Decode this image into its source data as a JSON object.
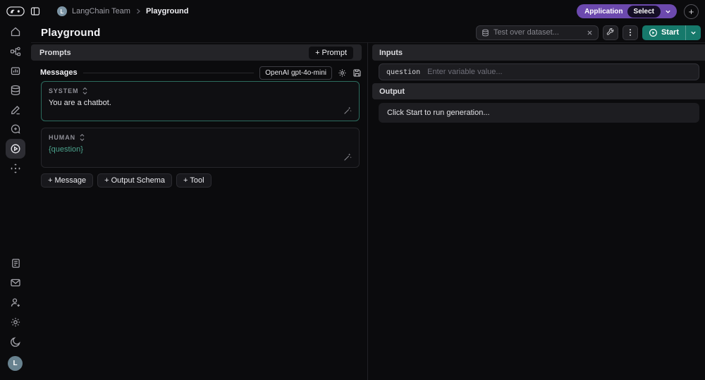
{
  "topbar": {
    "logo_icon": "langsmith-logo",
    "panel_icon": "sidebar-toggle-icon",
    "breadcrumb": {
      "avatar_letter": "L",
      "team": "LangChain Team",
      "page": "Playground"
    },
    "application_button": {
      "label": "Application",
      "select_label": "Select",
      "chevron_icon": "chevron-down-icon"
    },
    "new_button_label": "+"
  },
  "header": {
    "title": "Playground",
    "dataset_search": {
      "placeholder": "Test over dataset...",
      "value": "",
      "left_icon": "database-icon",
      "clear_icon": "x-icon"
    },
    "wrench_icon": "wrench-icon",
    "more_icon": "kebab-menu-icon",
    "start_button": {
      "label": "Start",
      "icon": "play-circle-icon",
      "chevron_icon": "chevron-down-icon"
    }
  },
  "sidebar": {
    "top_icons": [
      "home",
      "tracing-projects",
      "monitoring",
      "datasets",
      "annotation-queues",
      "feedback",
      "playground",
      "deployments"
    ],
    "active_item": "playground",
    "bottom_icons": [
      "docs",
      "email",
      "invite-user",
      "settings",
      "dark-mode"
    ],
    "avatar_letter": "L"
  },
  "prompts_panel": {
    "header": "Prompts",
    "add_prompt_label": "+ Prompt",
    "messages_label": "Messages",
    "model_label": "OpenAI gpt-4o-mini",
    "model_icons": [
      "gear-icon",
      "save-icon"
    ],
    "messages": [
      {
        "role": "SYSTEM",
        "content": "You are a chatbot."
      },
      {
        "role": "HUMAN",
        "content": "{question}"
      }
    ],
    "add_buttons": {
      "message": "+ Message",
      "output_schema": "+ Output Schema",
      "tool": "+ Tool"
    }
  },
  "io_panel": {
    "inputs_header": "Inputs",
    "variable": {
      "name": "question",
      "placeholder": "Enter variable value...",
      "value": ""
    },
    "output_header": "Output",
    "output_placeholder": "Click Start to run generation..."
  },
  "colors": {
    "background": "#0b0b0d",
    "panel_header": "#242428",
    "accent_purple": "#6c49ae",
    "accent_green": "#16796b",
    "variable_text": "#4ba28c",
    "system_border": "#2c6b5e"
  }
}
